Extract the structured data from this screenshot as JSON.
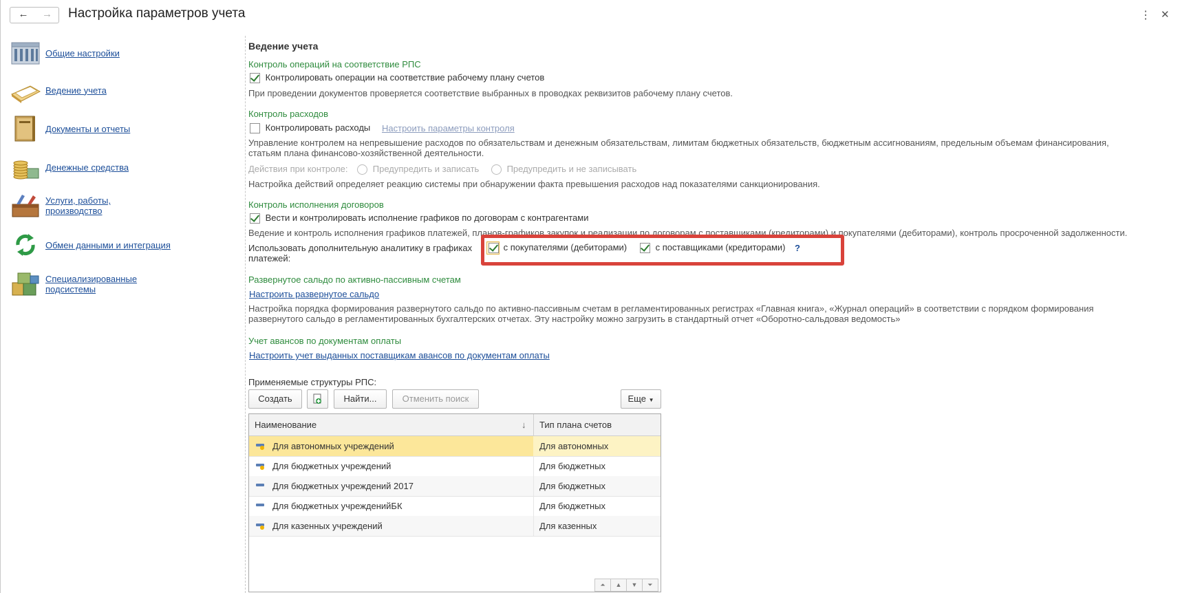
{
  "window": {
    "title": "Настройка параметров учета",
    "back_icon": "←",
    "forward_icon": "→",
    "more_icon": "⋮",
    "close_icon": "✕"
  },
  "sidebar": {
    "items": [
      {
        "label": "Общие настройки",
        "icon": "building-icon"
      },
      {
        "label": "Ведение учета",
        "icon": "ledger-icon"
      },
      {
        "label": "Документы и отчеты",
        "icon": "book-icon"
      },
      {
        "label": "Денежные средства",
        "icon": "coins-icon"
      },
      {
        "label_line1": "Услуги, работы,",
        "label_line2": "производство",
        "icon": "toolbox-icon"
      },
      {
        "label": "Обмен данными и интеграция",
        "icon": "sync-icon"
      },
      {
        "label_line1": "Специализированные",
        "label_line2": "подсистемы",
        "icon": "cubes-icon"
      }
    ]
  },
  "main": {
    "section_title": "Ведение учета",
    "rps": {
      "title": "Контроль операций на соответствие РПС",
      "checkbox_label": "Контролировать операции на соответствие рабочему плану счетов",
      "checked": true,
      "hint": "При проведении документов проверяется соответствие выбранных в проводках реквизитов рабочему плану счетов."
    },
    "expenses": {
      "title": "Контроль расходов",
      "checkbox_label": "Контролировать расходы",
      "checked": false,
      "settings_link": "Настроить параметры контроля",
      "hint_line1": "Управление контролем на непревышение расходов по обязательствам и денежным обязательствам, лимитам бюджетных обязательств, бюджетным ассигнованиям, предельным объемам финансирования,",
      "hint_line2": "статьям плана финансово-хозяйственной деятельности.",
      "actions_label": "Действия при контроле:",
      "radio1": "Предупредить и записать",
      "radio2": "Предупредить и не записывать",
      "actions_hint": "Настройка действий определяет реакцию системы при обнаружении факта превышения расходов над показателями санкционирования."
    },
    "contracts": {
      "title": "Контроль исполнения договоров",
      "checkbox_label": "Вести и контролировать исполнение графиков по договорам с контрагентами",
      "checked": true,
      "hint": "Ведение и контроль исполнения графиков платежей, планов-графиков закупок и реализации по договорам с поставщиками (кредиторами) и покупателями (дебиторами), контроль просроченной задолженности.",
      "analytics_label_line1": "Использовать дополнительную аналитику в графиках",
      "analytics_label_line2": "платежей:",
      "buyers_label": "с покупателями (дебиторами)",
      "buyers_checked": true,
      "suppliers_label": "с поставщиками (кредиторами)",
      "suppliers_checked": true,
      "help": "?"
    },
    "saldo": {
      "title": "Развернутое сальдо по активно-пассивным счетам",
      "link": "Настроить развернутое сальдо",
      "hint_line1": "Настройка порядка формирования развернутого сальдо по активно-пассивным счетам в регламентированных регистрах «Главная книга», «Журнал операций» в соответствии с порядком формирования",
      "hint_line2": "развернутого сальдо в регламентированных бухгалтерских отчетах. Эту настройку можно загрузить в стандартный отчет «Оборотно-сальдовая ведомость»"
    },
    "advances": {
      "title": "Учет авансов по документам оплаты",
      "link": "Настроить учет выданных поставщикам авансов по документам оплаты"
    },
    "structures": {
      "label": "Применяемые структуры РПС:",
      "btn_create": "Создать",
      "btn_find": "Найти...",
      "btn_cancel_search": "Отменить поиск",
      "btn_more": "Еще",
      "columns": [
        "Наименование",
        "Тип плана счетов"
      ],
      "sort_indicator": "↓",
      "rows": [
        {
          "name": "Для автономных учреждений",
          "type": "Для автономных",
          "icon_dot": true,
          "selected": true
        },
        {
          "name": "Для бюджетных учреждений",
          "type": "Для бюджетных",
          "icon_dot": true,
          "selected": false
        },
        {
          "name": "Для бюджетных учреждений 2017",
          "type": "Для бюджетных",
          "icon_dot": false,
          "selected": false
        },
        {
          "name": "Для бюджетных учрежденийБК",
          "type": "Для бюджетных",
          "icon_dot": false,
          "selected": false
        },
        {
          "name": "Для казенных учреждений",
          "type": "Для казенных",
          "icon_dot": true,
          "selected": false
        }
      ]
    }
  },
  "colors": {
    "accent_green": "#2e8b3d",
    "link_blue": "#1c4e99",
    "highlight_red": "#d9433b",
    "selected_row": "#fce79a"
  }
}
